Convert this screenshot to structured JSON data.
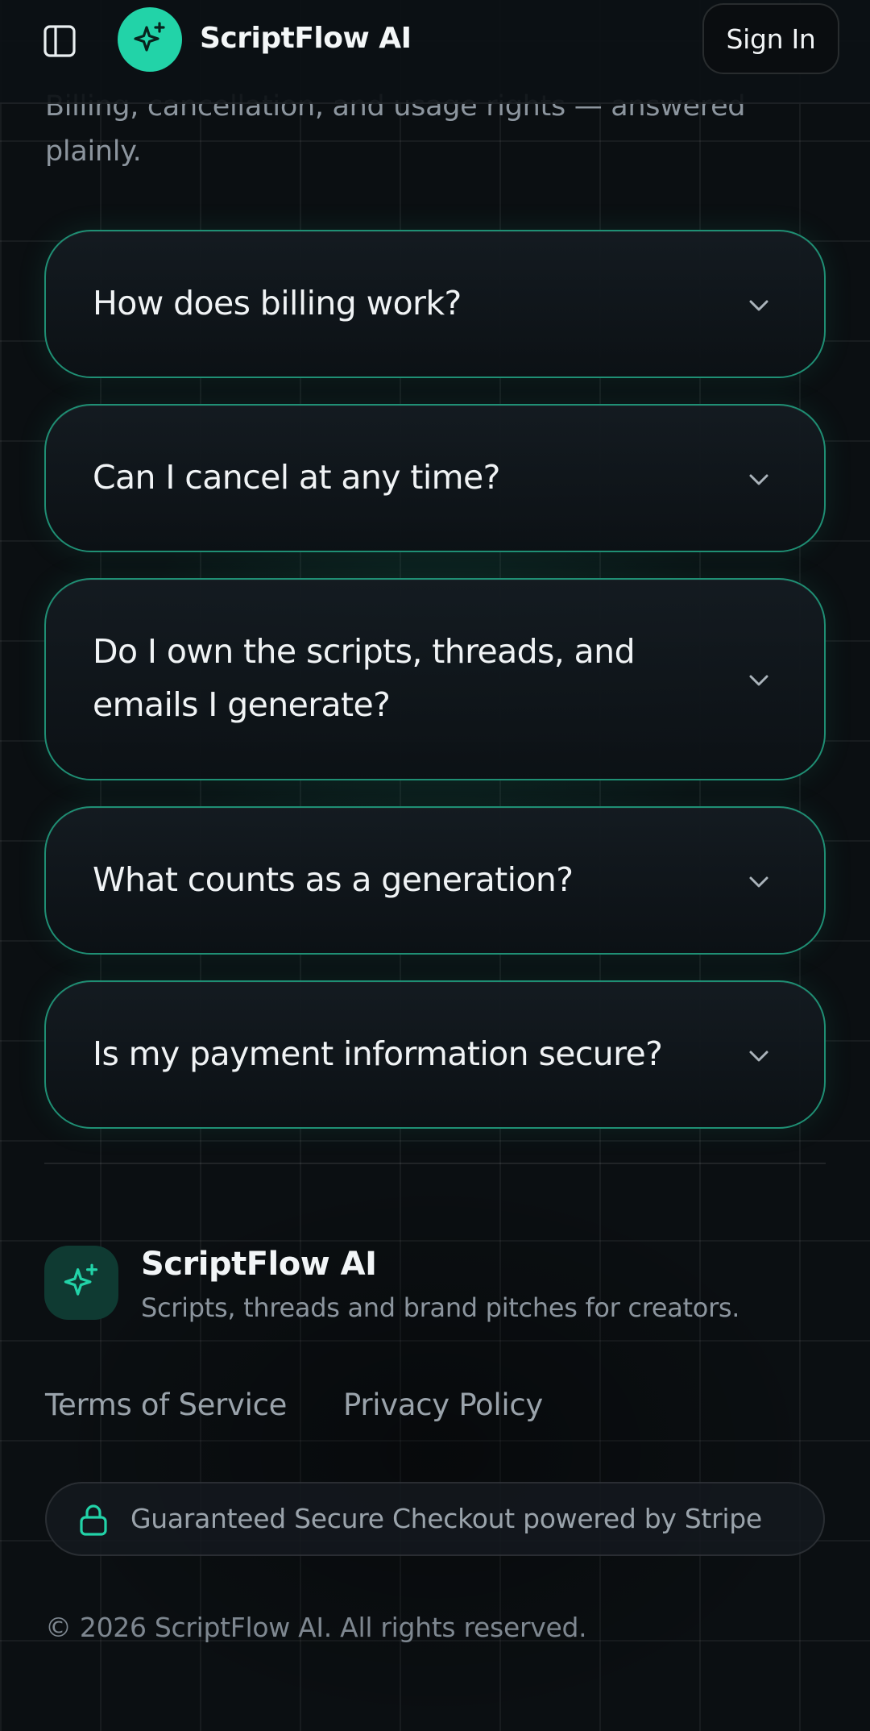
{
  "header": {
    "brand": "ScriptFlow AI",
    "sign_in_label": "Sign In",
    "menu_icon": "sidebar-toggle-icon",
    "logo_icon": "sparkles-icon"
  },
  "intro": {
    "subtitle": "Billing, cancellation, and usage rights — answered plainly."
  },
  "faq": {
    "items": [
      {
        "question": "How does billing work?"
      },
      {
        "question": "Can I cancel at any time?"
      },
      {
        "question": "Do I own the scripts, threads, and emails I generate?"
      },
      {
        "question": "What counts as a generation?"
      },
      {
        "question": "Is my payment information secure?"
      }
    ],
    "chevron_icon": "chevron-down-icon"
  },
  "footer": {
    "brand": "ScriptFlow AI",
    "tagline": "Scripts, threads and brand pitches for creators.",
    "links": {
      "terms": "Terms of Service",
      "privacy": "Privacy Policy"
    },
    "secure_badge": "Guaranteed Secure Checkout powered by Stripe",
    "copyright": "© 2026 ScriptFlow AI. All rights reserved."
  },
  "colors": {
    "accent": "#22d3a8",
    "border_accent": "#1f8f74",
    "background": "#0b0f12",
    "muted_text": "#8c959e"
  }
}
